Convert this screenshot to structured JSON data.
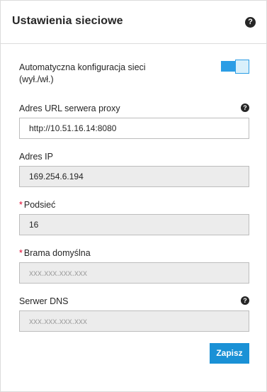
{
  "header": {
    "title": "Ustawienia sieciowe",
    "help_glyph": "?"
  },
  "auto_config": {
    "label": "Automatyczna konfiguracja sieci",
    "sublabel": "(wył./wł.)",
    "toggle_state": "on"
  },
  "proxy": {
    "label": "Adres URL serwera proxy",
    "value": "http://10.51.16.14:8080",
    "help_glyph": "?"
  },
  "ip": {
    "label": "Adres IP",
    "value": "169.254.6.194"
  },
  "subnet": {
    "required_mark": "*",
    "label": "Podsieć",
    "value": "16"
  },
  "gateway": {
    "required_mark": "*",
    "label": "Brama domyślna",
    "placeholder": "xxx.xxx.xxx.xxx"
  },
  "dns": {
    "label": "Serwer DNS",
    "placeholder": "xxx.xxx.xxx.xxx",
    "help_glyph": "?"
  },
  "actions": {
    "save_label": "Zapisz"
  },
  "colors": {
    "accent": "#1a91d6",
    "required": "#e0002a",
    "readonly_bg": "#ececec"
  },
  "icons": [
    "help-icon"
  ]
}
